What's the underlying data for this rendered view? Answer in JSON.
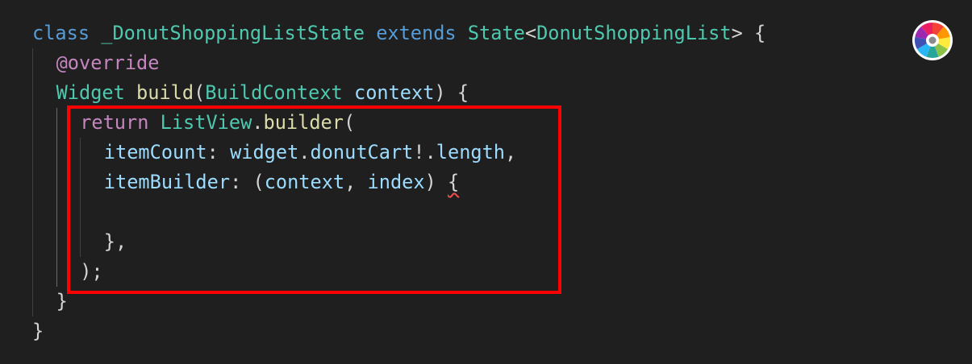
{
  "editor": {
    "lines": [
      {
        "indent": 0,
        "tokens": [
          {
            "text": "class",
            "kind": "keyword-blue"
          },
          {
            "text": " ",
            "kind": "punct"
          },
          {
            "text": "_DonutShoppingListState",
            "kind": "class"
          },
          {
            "text": " ",
            "kind": "punct"
          },
          {
            "text": "extends",
            "kind": "keyword-blue"
          },
          {
            "text": " ",
            "kind": "punct"
          },
          {
            "text": "State",
            "kind": "type"
          },
          {
            "text": "<",
            "kind": "punct"
          },
          {
            "text": "DonutShoppingList",
            "kind": "type"
          },
          {
            "text": "> {",
            "kind": "punct"
          }
        ]
      },
      {
        "indent": 1,
        "tokens": [
          {
            "text": "@override",
            "kind": "annotation"
          }
        ]
      },
      {
        "indent": 1,
        "tokens": [
          {
            "text": "Widget",
            "kind": "type"
          },
          {
            "text": " ",
            "kind": "punct"
          },
          {
            "text": "build",
            "kind": "func"
          },
          {
            "text": "(",
            "kind": "punct"
          },
          {
            "text": "BuildContext",
            "kind": "type"
          },
          {
            "text": " ",
            "kind": "punct"
          },
          {
            "text": "context",
            "kind": "var"
          },
          {
            "text": ") {",
            "kind": "punct"
          }
        ]
      },
      {
        "indent": 2,
        "tokens": [
          {
            "text": "return",
            "kind": "return"
          },
          {
            "text": " ",
            "kind": "punct"
          },
          {
            "text": "ListView",
            "kind": "type"
          },
          {
            "text": ".",
            "kind": "punct"
          },
          {
            "text": "builder",
            "kind": "func"
          },
          {
            "text": "(",
            "kind": "punct"
          }
        ]
      },
      {
        "indent": 3,
        "tokens": [
          {
            "text": "itemCount",
            "kind": "var"
          },
          {
            "text": ": ",
            "kind": "punct"
          },
          {
            "text": "widget",
            "kind": "var"
          },
          {
            "text": ".",
            "kind": "punct"
          },
          {
            "text": "donutCart",
            "kind": "var"
          },
          {
            "text": "!.",
            "kind": "punct"
          },
          {
            "text": "length",
            "kind": "var"
          },
          {
            "text": ",",
            "kind": "punct"
          }
        ]
      },
      {
        "indent": 3,
        "tokens": [
          {
            "text": "itemBuilder",
            "kind": "var"
          },
          {
            "text": ": (",
            "kind": "punct"
          },
          {
            "text": "context",
            "kind": "var"
          },
          {
            "text": ", ",
            "kind": "punct"
          },
          {
            "text": "index",
            "kind": "var"
          },
          {
            "text": ") ",
            "kind": "punct"
          },
          {
            "text": "{",
            "kind": "error"
          }
        ]
      },
      {
        "indent": 3,
        "tokens": []
      },
      {
        "indent": 3,
        "tokens": [
          {
            "text": "},",
            "kind": "punct"
          }
        ]
      },
      {
        "indent": 2,
        "tokens": [
          {
            "text": ");",
            "kind": "punct"
          }
        ]
      },
      {
        "indent": 1,
        "tokens": [
          {
            "text": "}",
            "kind": "punct"
          }
        ]
      },
      {
        "indent": 0,
        "tokens": [
          {
            "text": "}",
            "kind": "punct"
          }
        ]
      }
    ]
  },
  "highlight": {
    "color": "#ff0000",
    "from_line": 4,
    "to_line": 9
  },
  "toolbar": {
    "icon": "color-wheel-icon"
  },
  "colors": {
    "background": "#1f1f1f",
    "keyword": "#569cd6",
    "type": "#4ec9b0",
    "control": "#c586c0",
    "function": "#dcdcaa",
    "variable": "#9cdcfe",
    "text": "#d4d4d4",
    "error_squiggle": "#f14c4c"
  }
}
